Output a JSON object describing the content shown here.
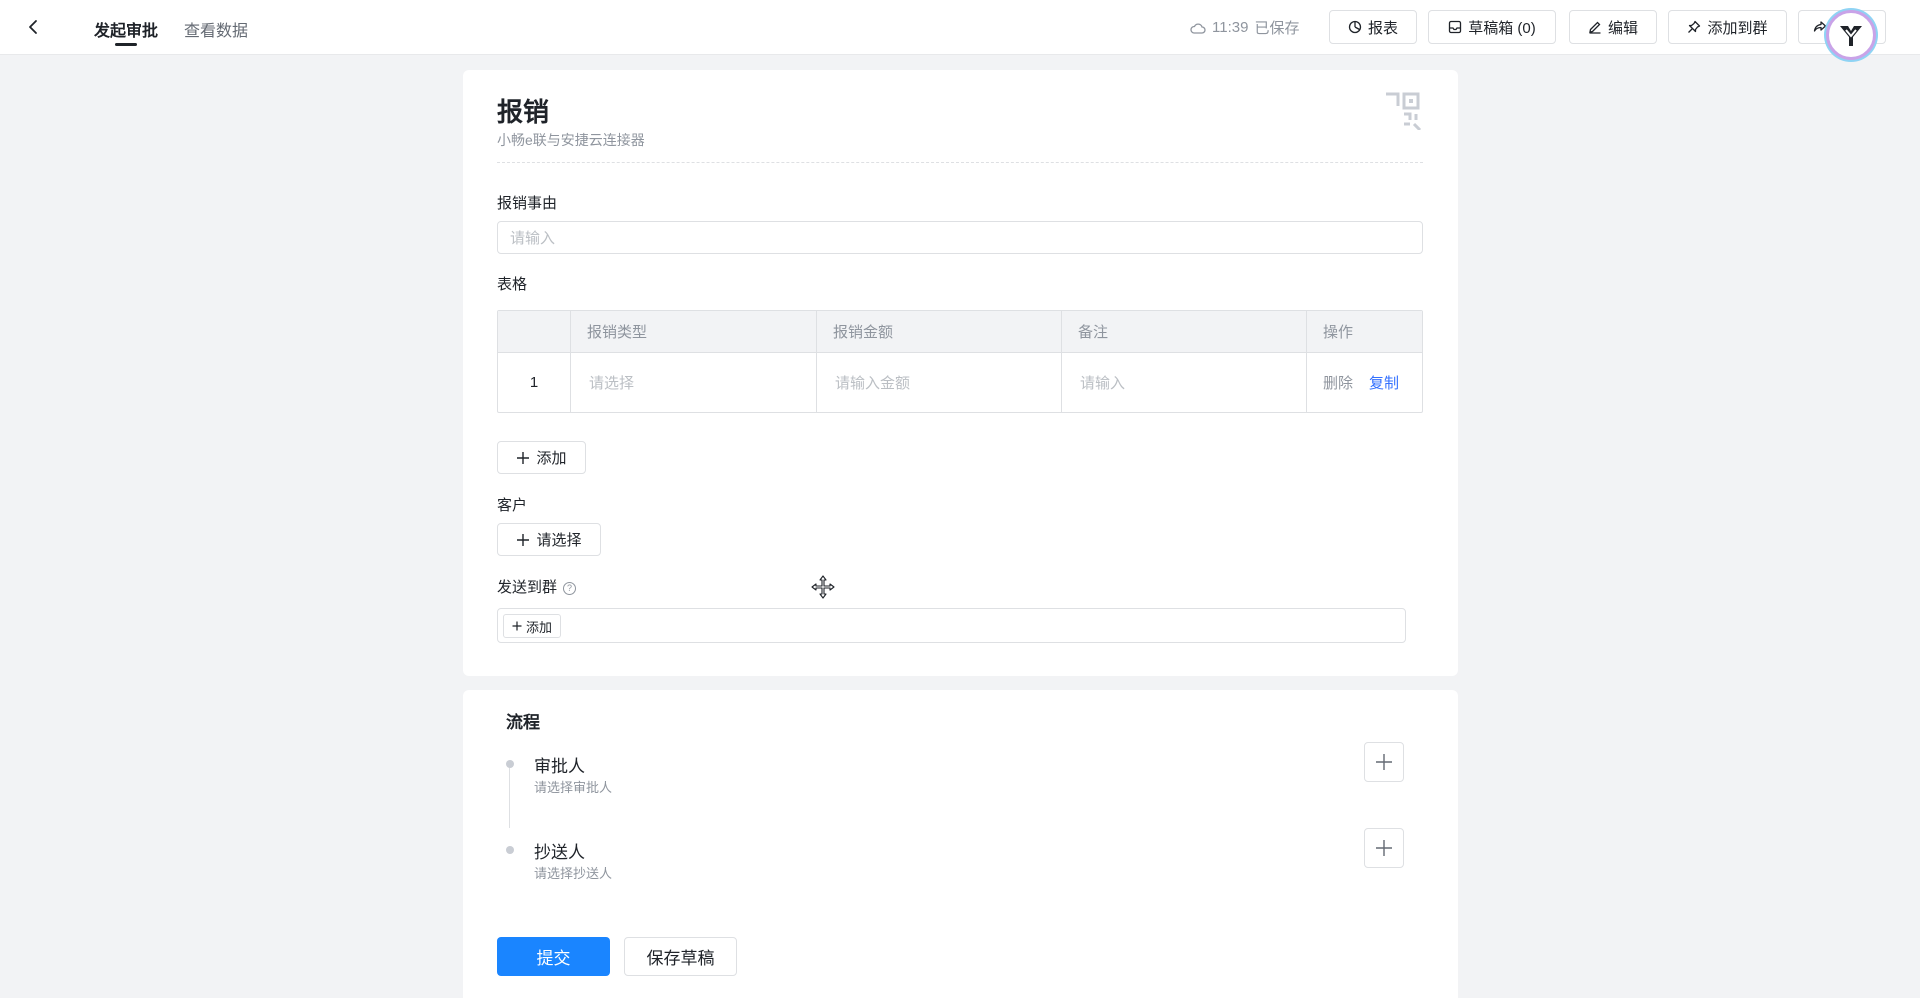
{
  "header": {
    "back_icon": "chevron-left-icon",
    "tabs": [
      {
        "label": "发起审批",
        "active": true
      },
      {
        "label": "查看数据",
        "active": false
      }
    ],
    "save_time": "11:39",
    "save_status": "已保存",
    "buttons": {
      "report": "报表",
      "drafts": "草稿箱 (0)",
      "edit": "编辑",
      "add_to_group": "添加到群"
    }
  },
  "form": {
    "title": "报销",
    "subtitle": "小畅e联与安捷云连接器",
    "reason": {
      "label": "报销事由",
      "placeholder": "请输入"
    },
    "table": {
      "label": "表格",
      "columns": [
        "",
        "报销类型",
        "报销金额",
        "备注",
        "操作"
      ],
      "rows": [
        {
          "index": "1",
          "type_placeholder": "请选择",
          "amount_placeholder": "请输入金额",
          "note_placeholder": "请输入",
          "delete": "删除",
          "copy": "复制"
        }
      ],
      "add_label": "添加"
    },
    "customer": {
      "label": "客户",
      "select_label": "请选择"
    },
    "send_to_group": {
      "label": "发送到群",
      "add_label": "添加"
    }
  },
  "process": {
    "title": "流程",
    "approver": {
      "label": "审批人",
      "hint": "请选择审批人"
    },
    "cc": {
      "label": "抄送人",
      "hint": "请选择抄送人"
    }
  },
  "footer": {
    "submit": "提交",
    "save_draft": "保存草稿"
  },
  "colors": {
    "primary": "#1a85ff",
    "link": "#3370ff",
    "background": "#f2f3f5"
  }
}
